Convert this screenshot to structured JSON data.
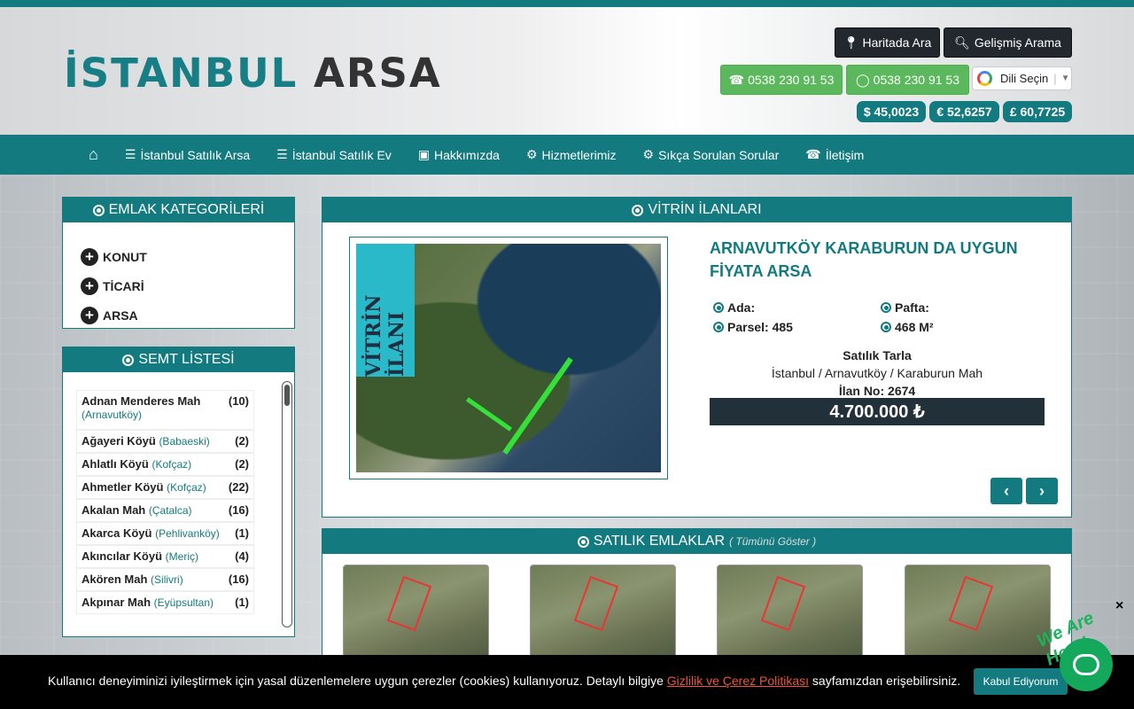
{
  "header": {
    "logo_part1": "İSTANBUL",
    "logo_part2": "ARSA",
    "map_search": "Haritada Ara",
    "advanced_search": "Gelişmiş Arama",
    "phone": "0538 230 91 53",
    "whatsapp": "0538 230 91 53",
    "language": "Dili Seçin",
    "currencies": [
      "$ 45,0023",
      "€ 52,6257",
      "£ 60,7725"
    ]
  },
  "nav": {
    "items": [
      "İstanbul Satılık Arsa",
      "İstanbul Satılık Ev",
      "Hakkımızda",
      "Hizmetlerimiz",
      "Sıkça Sorulan Sorular",
      "İletişim"
    ]
  },
  "categories": {
    "title": "EMLAK KATEGORİLERİ",
    "items": [
      "KONUT",
      "TİCARİ",
      "ARSA"
    ]
  },
  "semt": {
    "title": "SEMT LİSTESİ",
    "items": [
      {
        "name": "Adnan Menderes Mah",
        "district": "(Arnavutköy)",
        "count": "(10)"
      },
      {
        "name": "Ağayeri Köyü",
        "district": "(Babaeski)",
        "count": "(2)"
      },
      {
        "name": "Ahlatlı Köyü",
        "district": "(Kofçaz)",
        "count": "(2)"
      },
      {
        "name": "Ahmetler Köyü",
        "district": "(Kofçaz)",
        "count": "(22)"
      },
      {
        "name": "Akalan Mah",
        "district": "(Çatalca)",
        "count": "(16)"
      },
      {
        "name": "Akarca Köyü",
        "district": "(Pehlivanköy)",
        "count": "(1)"
      },
      {
        "name": "Akıncılar Köyü",
        "district": "(Meriç)",
        "count": "(4)"
      },
      {
        "name": "Akören Mah",
        "district": "(Silivri)",
        "count": "(16)"
      },
      {
        "name": "Akpınar Mah",
        "district": "(Eyüpsultan)",
        "count": "(1)"
      }
    ]
  },
  "vitrin": {
    "title": "VİTRİN İLANLARI",
    "ribbon": "VİTRİN İLANI",
    "listing_title": "ARNAVUTKÖY KARABURUN DA UYGUN FİYATA ARSA",
    "ada": "Ada:",
    "pafta": "Pafta:",
    "parsel": "Parsel: 485",
    "area": "468 M²",
    "type": "Satılık Tarla",
    "location": "İstanbul / Arnavutköy / Karaburun Mah",
    "ilan_no": "İlan No: 2674",
    "price": "4.700.000 ₺"
  },
  "satilik": {
    "title": "SATILIK EMLAKLAR",
    "show_all": "( Tümünü Göster )"
  },
  "cookie": {
    "text": "Kullanıcı deneyiminizi iyileştirmek için yasal düzenlemelere uygun çerezler (cookies) kullanıyoruz. Detaylı bilgiye",
    "link": "Gizlilik ve Çerez Politikası",
    "text2": "sayfamızdan erişebilirsiniz.",
    "accept": "Kabul Ediyorum"
  },
  "chat": {
    "badge": "We Are Here!",
    "close": "×"
  }
}
